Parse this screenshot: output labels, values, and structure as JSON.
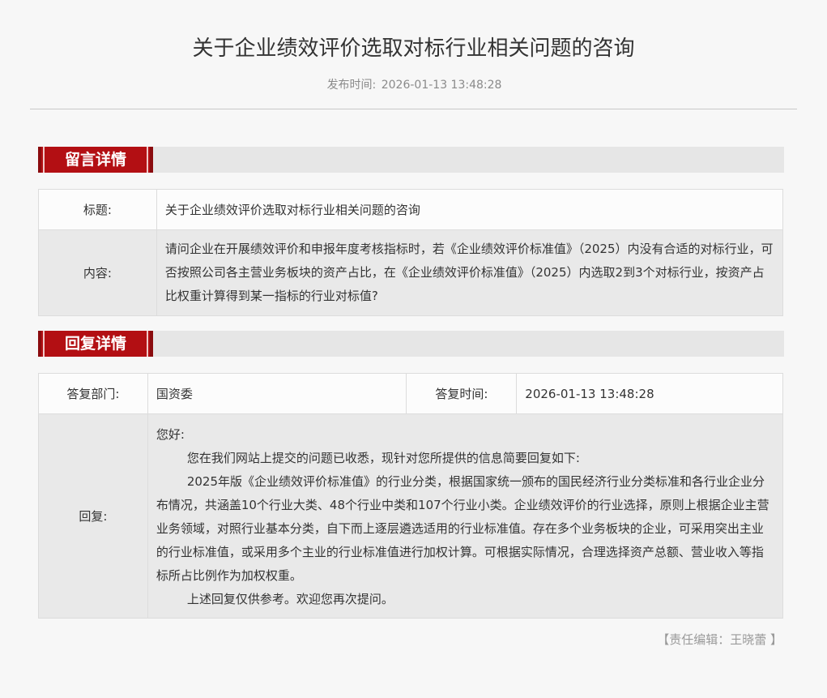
{
  "article": {
    "title": "关于企业绩效评价选取对标行业相关问题的咨询",
    "published_label": "发布时间:",
    "published_value": "2026-01-13 13:48:28"
  },
  "message_section": {
    "heading": "留言详情",
    "title_label": "标题:",
    "title_value": "关于企业绩效评价选取对标行业相关问题的咨询",
    "content_label": "内容:",
    "content_value": "请问企业在开展绩效评价和申报年度考核指标时，若《企业绩效评价标准值》（2025）内没有合适的对标行业，可否按照公司各主营业务板块的资产占比，在《企业绩效评价标准值》（2025）内选取2到3个对标行业，按资产占比权重计算得到某一指标的行业对标值?"
  },
  "reply_section": {
    "heading": "回复详情",
    "dept_label": "答复部门:",
    "dept_value": "国资委",
    "time_label": "答复时间:",
    "time_value": "2026-01-13 13:48:28",
    "reply_label": "回复:",
    "greeting": "您好:",
    "paragraphs": [
      "您在我们网站上提交的问题已收悉，现针对您所提供的信息简要回复如下:",
      "2025年版《企业绩效评价标准值》的行业分类，根据国家统一颁布的国民经济行业分类标准和各行业企业分布情况，共涵盖10个行业大类、48个行业中类和107个行业小类。企业绩效评价的行业选择，原则上根据企业主营业务领域，对照行业基本分类，自下而上逐层遴选适用的行业标准值。存在多个业务板块的企业，可采用突出主业的行业标准值，或采用多个主业的行业标准值进行加权计算。可根据实际情况，合理选择资产总额、营业收入等指标所占比例作为加权权重。",
      "上述回复仅供参考。欢迎您再次提问。"
    ]
  },
  "footer": {
    "editor_text": "【责任编辑：王晓蕾 】"
  },
  "colors": {
    "accent_red": "#b30f13",
    "background": "#f7f7f7"
  }
}
